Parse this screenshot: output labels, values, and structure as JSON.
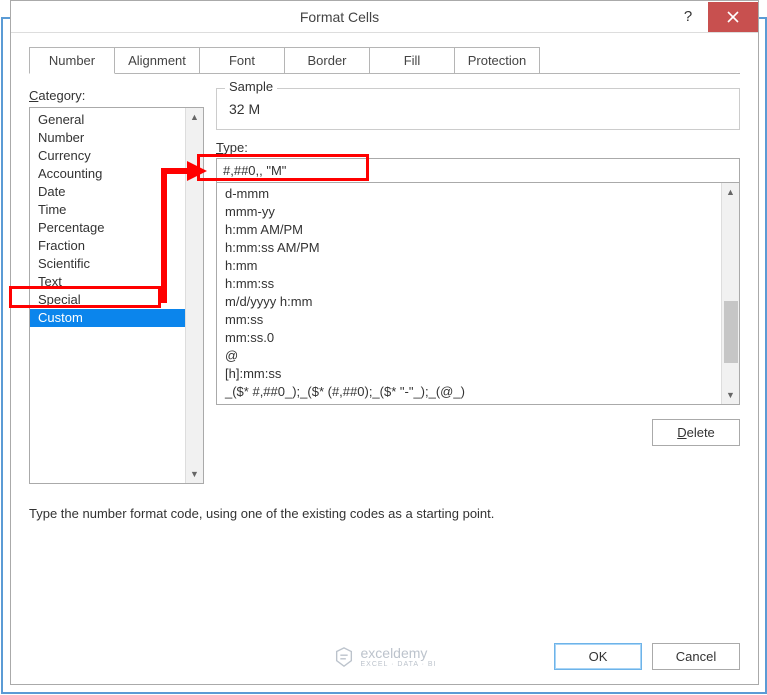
{
  "dialog": {
    "title": "Format Cells",
    "help": "?"
  },
  "tabs": [
    {
      "label": "Number",
      "active": true
    },
    {
      "label": "Alignment",
      "active": false
    },
    {
      "label": "Font",
      "active": false
    },
    {
      "label": "Border",
      "active": false
    },
    {
      "label": "Fill",
      "active": false
    },
    {
      "label": "Protection",
      "active": false
    }
  ],
  "category": {
    "label_pre": "C",
    "label_post": "ategory:",
    "items": [
      {
        "label": "General",
        "selected": false
      },
      {
        "label": "Number",
        "selected": false
      },
      {
        "label": "Currency",
        "selected": false
      },
      {
        "label": "Accounting",
        "selected": false
      },
      {
        "label": "Date",
        "selected": false
      },
      {
        "label": "Time",
        "selected": false
      },
      {
        "label": "Percentage",
        "selected": false
      },
      {
        "label": "Fraction",
        "selected": false
      },
      {
        "label": "Scientific",
        "selected": false
      },
      {
        "label": "Text",
        "selected": false
      },
      {
        "label": "Special",
        "selected": false
      },
      {
        "label": "Custom",
        "selected": true
      }
    ]
  },
  "sample": {
    "label": "Sample",
    "value": "32 M"
  },
  "type": {
    "label": "Type:",
    "value": "#,##0,, \"M\"",
    "items": [
      "d-mmm",
      "mmm-yy",
      "h:mm AM/PM",
      "h:mm:ss AM/PM",
      "h:mm",
      "h:mm:ss",
      "m/d/yyyy h:mm",
      "mm:ss",
      "mm:ss.0",
      "@",
      "[h]:mm:ss",
      "_($* #,##0_);_($* (#,##0);_($* \"-\"_);_(@_)"
    ]
  },
  "buttons": {
    "delete": "Delete",
    "ok": "OK",
    "cancel": "Cancel"
  },
  "description": "Type the number format code, using one of the existing codes as a starting point.",
  "watermark": {
    "name": "exceldemy",
    "sub": "EXCEL · DATA · BI"
  }
}
